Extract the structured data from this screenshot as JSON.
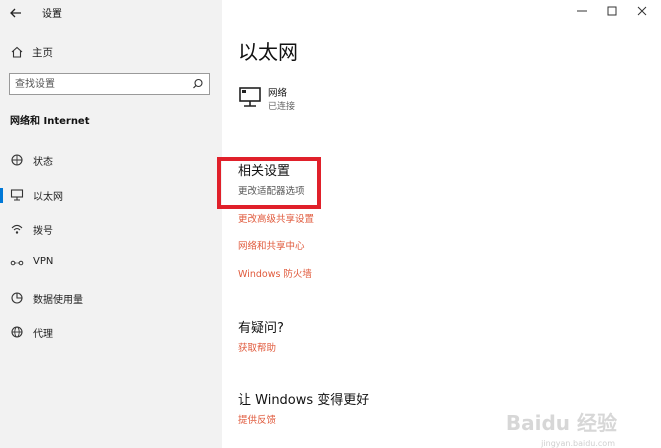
{
  "window": {
    "app_title": "设置",
    "controls": [
      "minimize-icon",
      "maximize-icon",
      "close-icon"
    ]
  },
  "sidebar": {
    "home_label": "主页",
    "search_placeholder": "查找设置",
    "section_title": "网络和 Internet",
    "items": [
      {
        "label": "状态",
        "icon": "status-icon"
      },
      {
        "label": "以太网",
        "icon": "ethernet-icon",
        "selected": true
      },
      {
        "label": "拨号",
        "icon": "dialup-icon"
      },
      {
        "label": "VPN",
        "icon": "vpn-icon"
      },
      {
        "label": "数据使用量",
        "icon": "data-usage-icon"
      },
      {
        "label": "代理",
        "icon": "proxy-icon"
      }
    ]
  },
  "main": {
    "title": "以太网",
    "network": {
      "name": "网络",
      "status": "已连接"
    },
    "related_settings": {
      "heading": "相关设置",
      "links": [
        "更改适配器选项",
        "更改高级共享设置",
        "网络和共享中心",
        "Windows 防火墙"
      ]
    },
    "questions": {
      "heading": "有疑问?",
      "link": "获取帮助"
    },
    "improve": {
      "heading": "让 Windows 变得更好",
      "link": "提供反馈"
    }
  },
  "watermark": {
    "text": "Baidu 经验",
    "sub": "jingyan.baidu.com"
  },
  "colors": {
    "accent": "#0078d7",
    "link": "#e05a3c",
    "highlight_box": "#e0202a",
    "sidebar_bg": "#f2f2f2"
  }
}
